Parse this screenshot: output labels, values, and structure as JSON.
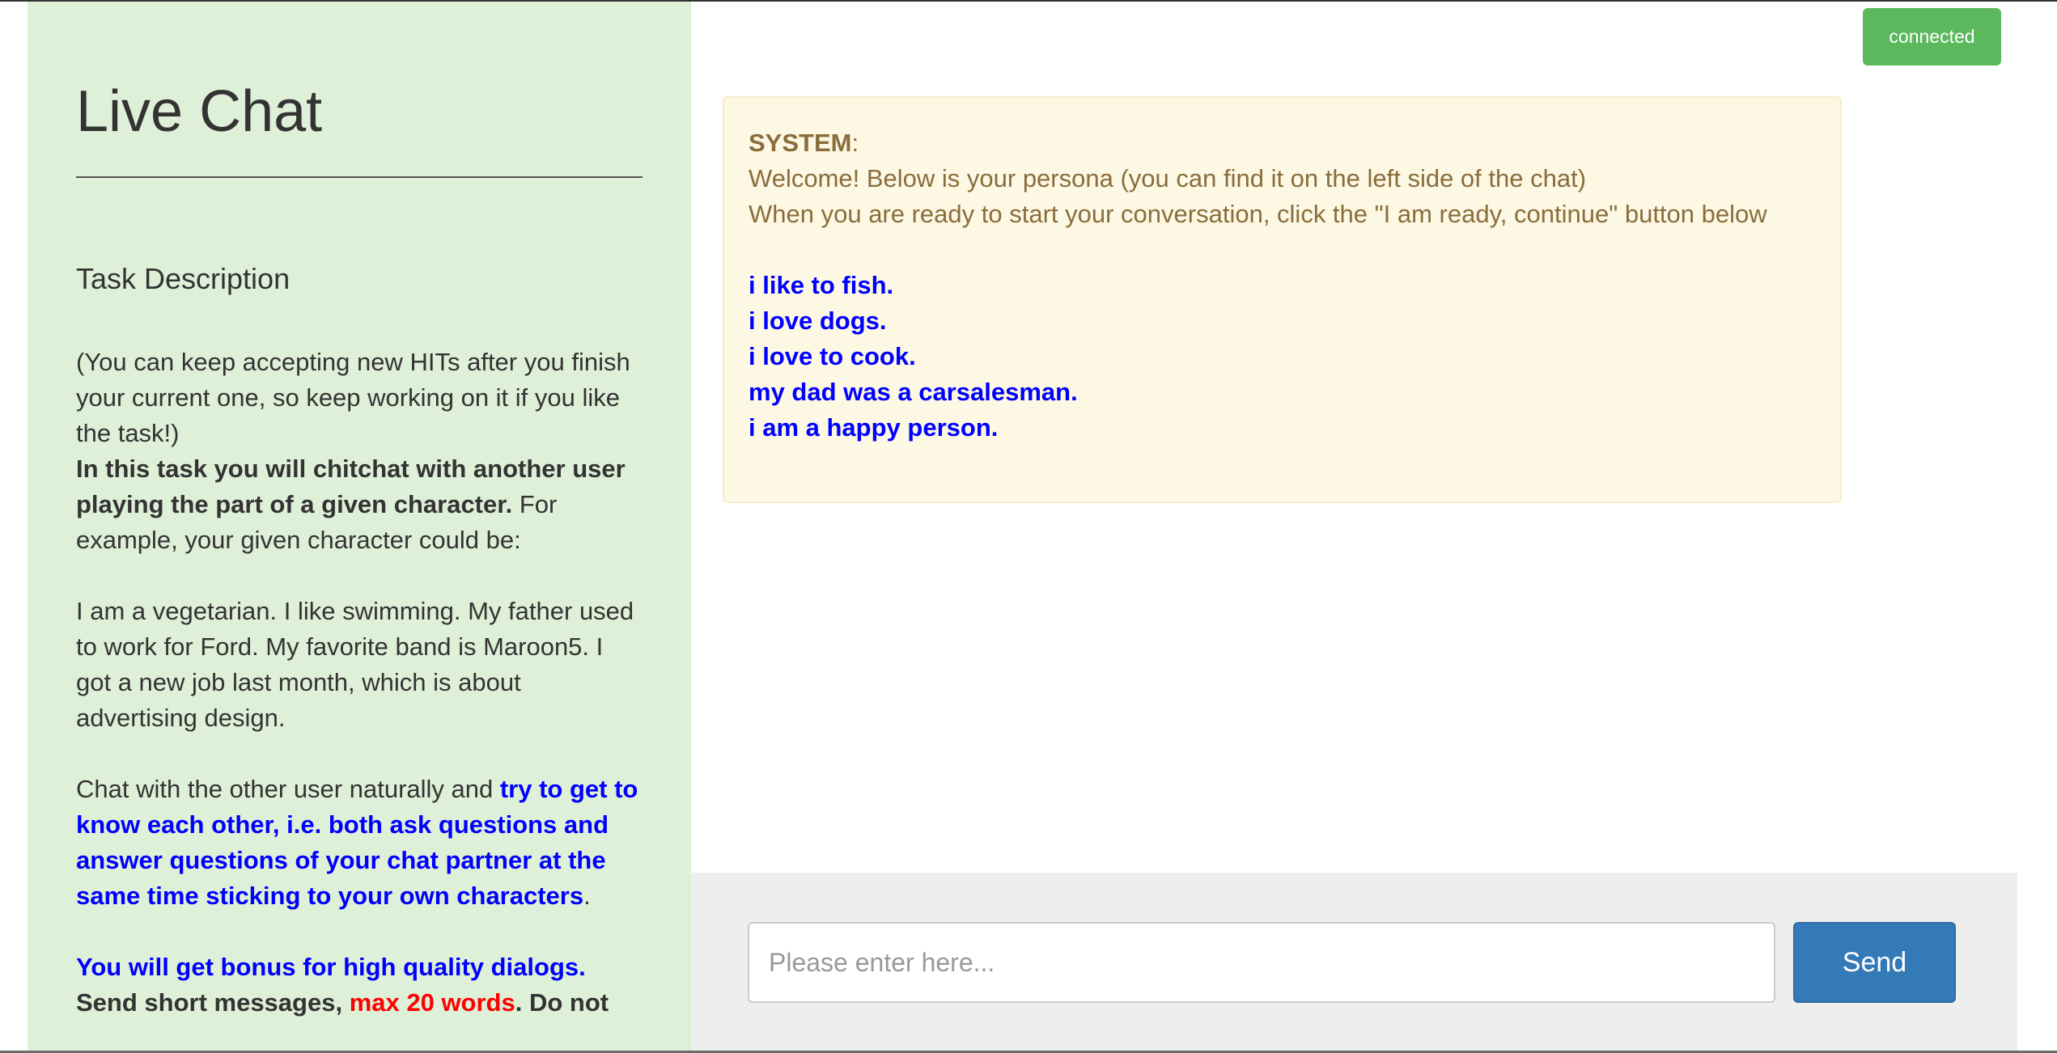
{
  "sidebar": {
    "title": "Live Chat",
    "task_heading": "Task Description",
    "intro": "(You can keep accepting new HITs after you finish your current one, so keep working on it if you like the task!)",
    "bold_instruction": "In this task you will chitchat with another user playing the part of a given character.",
    "example_lead": " For example, your given character could be:",
    "example_persona": "I am a vegetarian. I like swimming. My father used to work for Ford. My favorite band is Maroon5. I got a new job last month, which is about advertising design.",
    "chat_lead": "Chat with the other user naturally and ",
    "chat_emphasis": "try to get to know each other, i.e. both ask questions and answer questions of your chat partner at the same time sticking to your own characters",
    "chat_end": ".",
    "bonus": "You will get bonus for high quality dialogs.",
    "short_lead": "Send short messages, ",
    "short_limit": "max 20 words",
    "short_tail": ". Do not"
  },
  "status": {
    "label": "connected"
  },
  "system_message": {
    "label": "SYSTEM",
    "colon": ":",
    "line1": "Welcome! Below is your persona (you can find it on the left side of the chat)",
    "line2": "When you are ready to start your conversation, click the \"I am ready, continue\" button below",
    "persona": [
      "i like to fish.",
      "i love dogs.",
      "i love to cook.",
      "my dad was a carsalesman.",
      "i am a happy person."
    ]
  },
  "composer": {
    "placeholder": "Please enter here...",
    "value": "",
    "send_label": "Send"
  },
  "colors": {
    "sidebar_bg": "#dff0d8",
    "status_green": "#5cb85c",
    "system_bg": "#fcf8e3",
    "system_text": "#8a6d3b",
    "persona_blue": "#0000ff",
    "limit_red": "#ff0000",
    "send_blue": "#337ab7"
  }
}
